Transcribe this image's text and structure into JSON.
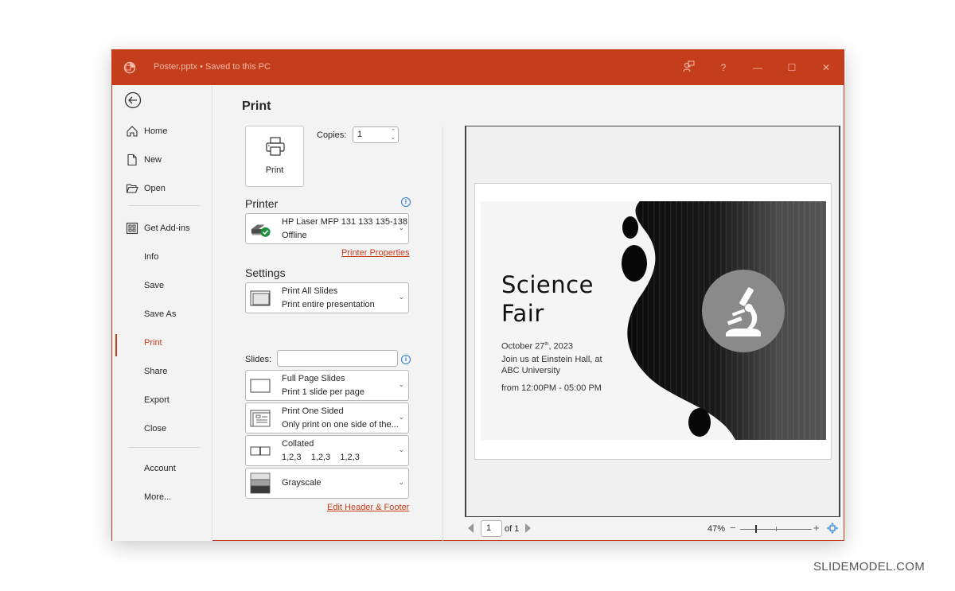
{
  "window": {
    "title": "Poster.pptx",
    "save_status": "Saved to this PC",
    "title_full": "Poster.pptx  •  Saved to this PC",
    "controls": {
      "coauthor_icon": "presenter-icon",
      "help": "?",
      "minimize": "—",
      "maximize": "☐",
      "close": "✕"
    },
    "accent_color": "#c43e1c"
  },
  "nav": {
    "back_icon": "back-arrow-icon",
    "items": [
      {
        "label": "Home",
        "icon": "home-icon"
      },
      {
        "label": "New",
        "icon": "new-document-icon"
      },
      {
        "label": "Open",
        "icon": "folder-open-icon"
      },
      {
        "label": "Get Add-ins",
        "icon": "add-ins-grid-icon"
      },
      {
        "label": "Info"
      },
      {
        "label": "Save"
      },
      {
        "label": "Save As"
      },
      {
        "label": "Print",
        "active": true
      },
      {
        "label": "Share"
      },
      {
        "label": "Export"
      },
      {
        "label": "Close"
      },
      {
        "label": "Account"
      },
      {
        "label": "More..."
      }
    ]
  },
  "print_panel": {
    "title": "Print",
    "print_button_label": "Print",
    "copies_label": "Copies:",
    "copies_value": "1",
    "printer_section": "Printer",
    "printer": {
      "name": "HP Laser MFP 131 133 135-138",
      "status": "Offline"
    },
    "printer_properties_link": "Printer Properties",
    "settings_section": "Settings",
    "settings": [
      {
        "line1": "Print All Slides",
        "line2": "Print entire presentation",
        "icon": "slides-stack-icon"
      },
      {
        "line1": "Full Page Slides",
        "line2": "Print 1 slide per page",
        "icon": "full-page-icon"
      },
      {
        "line1": "Print One Sided",
        "line2": "Only print on one side of the...",
        "icon": "one-sided-icon"
      },
      {
        "line1": "Collated",
        "line2": "1,2,3    1,2,3    1,2,3",
        "icon": "collated-icon"
      },
      {
        "line1": "Grayscale",
        "icon": "grayscale-icon"
      }
    ],
    "slides_label": "Slides:",
    "slides_value": "",
    "edit_header_footer_link": "Edit Header & Footer"
  },
  "preview": {
    "slide": {
      "title_line1": "Science",
      "title_line2": "Fair",
      "date_prefix": "October 27",
      "date_sup": "th",
      "date_suffix": ", 2023",
      "venue_line1": "Join us at Einstein Hall, at",
      "venue_line2": "ABC University",
      "time": "from 12:00PM - 05:00 PM",
      "emblem_icon": "microscope-icon"
    },
    "current_page": "1",
    "of_pages": "of 1",
    "zoom_percent": "47%",
    "zoom_minus": "−",
    "zoom_plus": "+"
  },
  "watermark": "SLIDEMODEL.COM"
}
